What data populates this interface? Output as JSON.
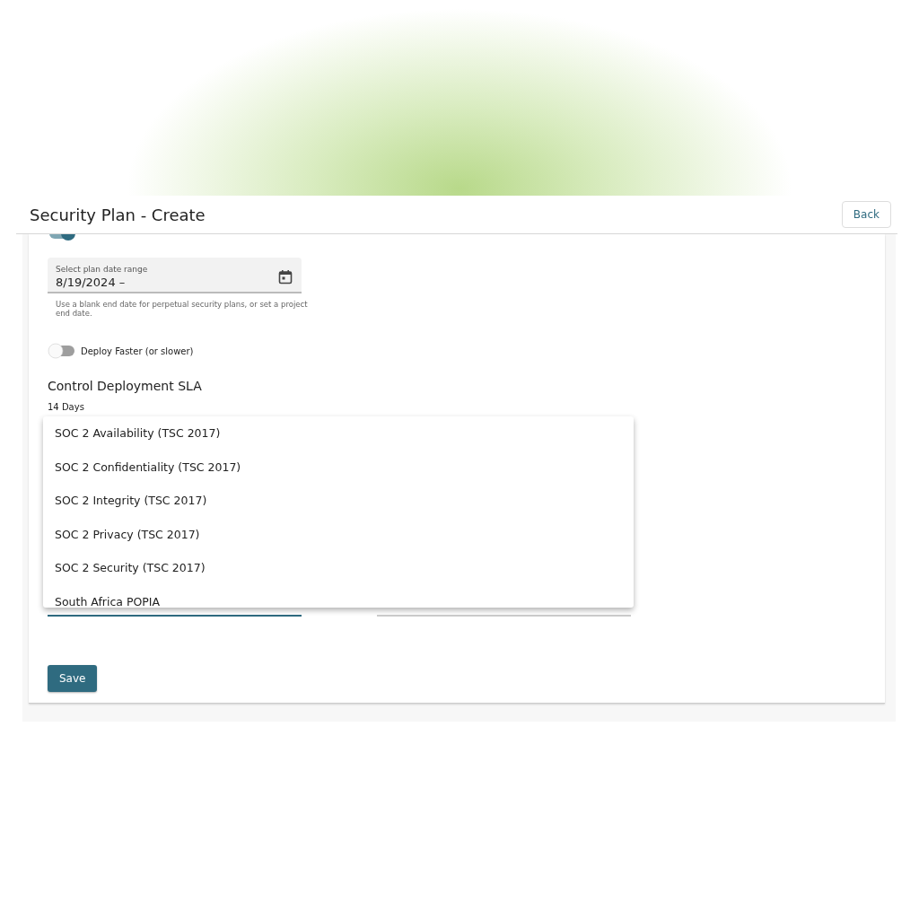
{
  "header": {
    "title": "Security Plan - Create",
    "back_button": "Back"
  },
  "form": {
    "enable_toggle": {
      "on": true
    },
    "date_range": {
      "label": "Select plan date range",
      "value": "8/19/2024 –",
      "helper": "Use a blank end date for perpetual security plans, or set a project end date."
    },
    "deploy_toggle": {
      "label": "Deploy Faster (or slower)",
      "on": false
    },
    "sla": {
      "heading": "Control Deployment SLA",
      "value": "14 Days"
    },
    "dropdown": {
      "options": [
        "SOC 2 Availability (TSC 2017)",
        "SOC 2 Confidentiality (TSC 2017)",
        "SOC 2 Integrity (TSC 2017)",
        "SOC 2 Privacy (TSC 2017)",
        "SOC 2 Security (TSC 2017)",
        "South Africa POPIA"
      ]
    },
    "save_button": "Save"
  }
}
